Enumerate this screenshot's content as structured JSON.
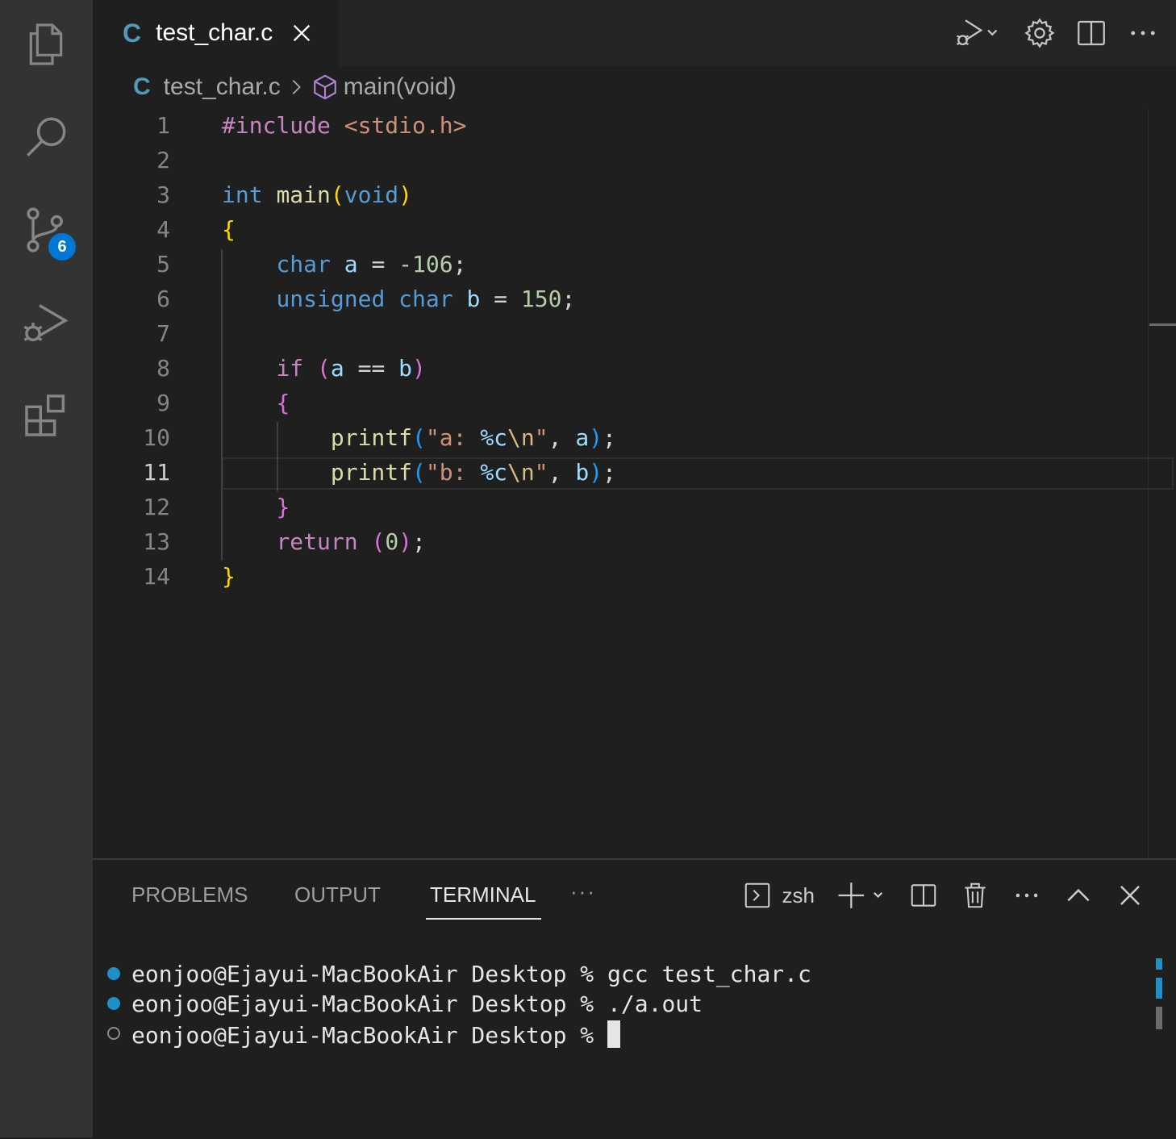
{
  "activity_bar": {
    "icons": [
      "explorer-icon",
      "search-icon",
      "source-control-icon",
      "run-debug-icon",
      "extensions-icon"
    ],
    "source_control_badge": "6"
  },
  "tab": {
    "file_type_glyph": "C",
    "title": "test_char.c"
  },
  "breadcrumb": {
    "file_glyph": "C",
    "file": "test_char.c",
    "symbol": "main(void)"
  },
  "editor": {
    "active_line": 11,
    "line_numbers": [
      "1",
      "2",
      "3",
      "4",
      "5",
      "6",
      "7",
      "8",
      "9",
      "10",
      "11",
      "12",
      "13",
      "14"
    ],
    "code": [
      "#include <stdio.h>",
      "",
      "int main(void)",
      "{",
      "    char a = -106;",
      "    unsigned char b = 150;",
      "",
      "    if (a == b)",
      "    {",
      "        printf(\"a: %c\\n\", a);",
      "        printf(\"b: %c\\n\", b);",
      "    }",
      "    return (0);",
      "}"
    ]
  },
  "panel": {
    "tabs": [
      "PROBLEMS",
      "OUTPUT",
      "TERMINAL"
    ],
    "active_tab": "TERMINAL",
    "more": "···",
    "shell": "zsh",
    "terminal_lines": [
      {
        "prompt": "eonjoo@Ejayui-MacBookAir Desktop % ",
        "command": "gcc test_char.c",
        "status": "done"
      },
      {
        "prompt": "eonjoo@Ejayui-MacBookAir Desktop % ",
        "command": "./a.out",
        "status": "done"
      },
      {
        "prompt": "eonjoo@Ejayui-MacBookAir Desktop % ",
        "command": "",
        "status": "pending"
      }
    ]
  },
  "colors": {
    "accent": "#0078d4",
    "terminal_dot_done": "#1e90c7"
  }
}
